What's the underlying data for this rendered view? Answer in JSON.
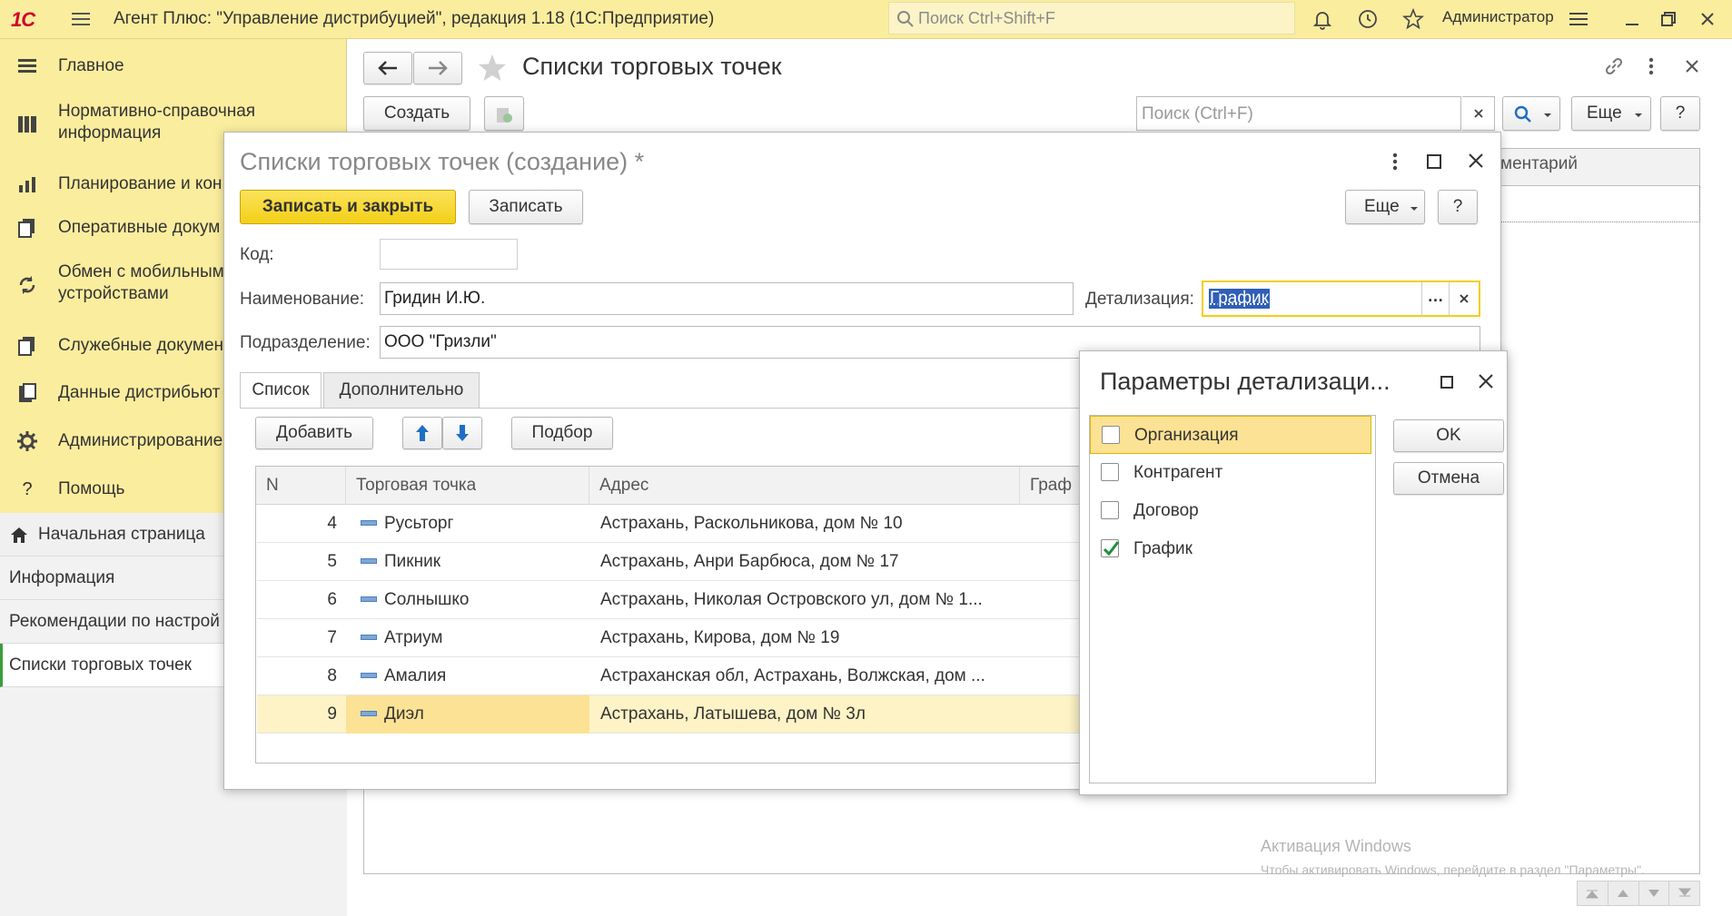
{
  "app": {
    "logo": "1С",
    "title": "Агент Плюс: \"Управление дистрибуцией\", редакция 1.18  (1С:Предприятие)",
    "search_placeholder": "Поиск Ctrl+Shift+F",
    "user": "Администратор"
  },
  "sidebar": {
    "items": [
      {
        "label": "Главное",
        "icon": "menu-lines-icon"
      },
      {
        "label": "Нормативно-справочная\nинформация",
        "icon": "catalog-icon"
      },
      {
        "label": "Планирование и кон",
        "icon": "chart-icon"
      },
      {
        "label": "Оперативные докум",
        "icon": "documents-icon"
      },
      {
        "label": "Обмен с мобильным\nустройствами",
        "icon": "sync-icon"
      },
      {
        "label": "Служебные докумен",
        "icon": "service-doc-icon"
      },
      {
        "label": "Данные дистрибьют",
        "icon": "data-icon"
      },
      {
        "label": "Администрирование",
        "icon": "gear-icon"
      },
      {
        "label": "Помощь",
        "icon": "question-icon"
      }
    ],
    "open_windows": [
      {
        "label": "Начальная страница",
        "icon": "home-icon"
      },
      {
        "label": "Информация"
      },
      {
        "label": "Рекомендации по настрой"
      },
      {
        "label": "Списки торговых точек"
      }
    ]
  },
  "main": {
    "title": "Списки торговых точек",
    "create_label": "Создать",
    "search_placeholder": "Поиск (Ctrl+F)",
    "more_label": "Еще",
    "help_label": "?",
    "col_comment": "ментарий"
  },
  "dialog": {
    "title": "Списки торговых точек (создание) *",
    "save_close_label": "Записать и закрыть",
    "save_label": "Записать",
    "more_label": "Еще",
    "help_label": "?",
    "code_label": "Код:",
    "code_value": "",
    "name_label": "Наименование:",
    "name_value": "Гридин И.Ю.",
    "detail_label": "Детализация:",
    "detail_value": "График",
    "dept_label": "Подразделение:",
    "dept_value": "ООО \"Гризли\"",
    "tabs": [
      "Список",
      "Дополнительно"
    ],
    "add_label": "Добавить",
    "pick_label": "Подбор",
    "table": {
      "headers": [
        "N",
        "Торговая точка",
        "Адрес",
        "Граф"
      ],
      "rows": [
        {
          "n": "4",
          "point": "Русьторг",
          "address": "Астрахань, Раскольникова, дом № 10"
        },
        {
          "n": "5",
          "point": "Пикник",
          "address": "Астрахань, Анри Барбюса, дом № 17"
        },
        {
          "n": "6",
          "point": "Солнышко",
          "address": "Астрахань, Николая Островского ул, дом № 1..."
        },
        {
          "n": "7",
          "point": "Атриум",
          "address": "Астрахань, Кирова, дом № 19"
        },
        {
          "n": "8",
          "point": "Амалия",
          "address": "Астраханская обл, Астрахань, Волжская, дом ..."
        },
        {
          "n": "9",
          "point": "Диэл",
          "address": "Астрахань, Латышева, дом № 3л"
        }
      ]
    }
  },
  "params": {
    "title": "Параметры детализаци...",
    "ok_label": "OK",
    "cancel_label": "Отмена",
    "items": [
      {
        "label": "Организация",
        "checked": false
      },
      {
        "label": "Контрагент",
        "checked": false
      },
      {
        "label": "Договор",
        "checked": false
      },
      {
        "label": "График",
        "checked": true
      }
    ]
  },
  "windows_activation": {
    "title": "Активация Windows",
    "subtitle": "Чтобы активировать Windows, перейдите в раздел \"Параметры\"."
  },
  "colors": {
    "header_bg": "#fbed9e",
    "accent_yellow": "#f6d92a",
    "selection": "#fbe294",
    "check_green": "#1d8f3a"
  }
}
